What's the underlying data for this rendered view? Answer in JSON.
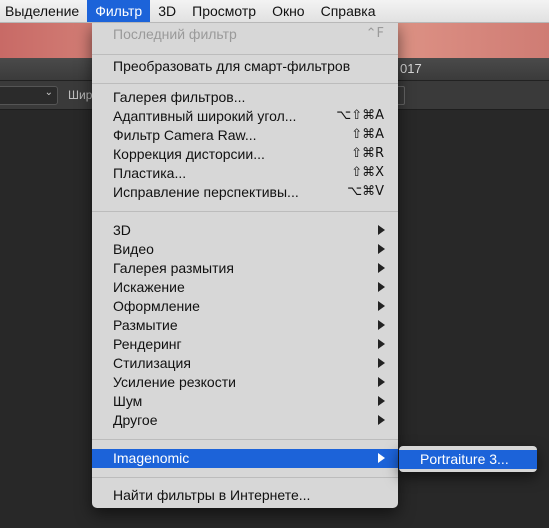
{
  "menubar": {
    "items": [
      {
        "label": "Выделение"
      },
      {
        "label": "Фильтр"
      },
      {
        "label": "3D"
      },
      {
        "label": "Просмотр"
      },
      {
        "label": "Окно"
      },
      {
        "label": "Справка"
      }
    ],
    "active": "Фильтр"
  },
  "app": {
    "title_fragment": "017",
    "options_label_fragment": "Шир"
  },
  "filter_menu": {
    "last_filter": {
      "label": "Последний фильтр",
      "shortcut": "⌃F",
      "disabled": true
    },
    "convert_smart": {
      "label": "Преобразовать для смарт-фильтров"
    },
    "gallery": {
      "label": "Галерея фильтров..."
    },
    "adaptive_wide": {
      "label": "Адаптивный широкий угол...",
      "shortcut": "⌥⇧⌘A"
    },
    "camera_raw": {
      "label": "Фильтр Camera Raw...",
      "shortcut": "⇧⌘A"
    },
    "lens_correction": {
      "label": "Коррекция дисторсии...",
      "shortcut": "⇧⌘R"
    },
    "liquify": {
      "label": "Пластика...",
      "shortcut": "⇧⌘X"
    },
    "vanishing_point": {
      "label": "Исправление перспективы...",
      "shortcut": "⌥⌘V"
    },
    "submenus": [
      {
        "label": "3D"
      },
      {
        "label": "Видео"
      },
      {
        "label": "Галерея размытия"
      },
      {
        "label": "Искажение"
      },
      {
        "label": "Оформление"
      },
      {
        "label": "Размытие"
      },
      {
        "label": "Рендеринг"
      },
      {
        "label": "Стилизация"
      },
      {
        "label": "Усиление резкости"
      },
      {
        "label": "Шум"
      },
      {
        "label": "Другое"
      }
    ],
    "imagenomic": {
      "label": "Imagenomic",
      "highlighted": true
    },
    "browse_online": {
      "label": "Найти фильтры в Интернете..."
    }
  },
  "imagenomic_submenu": {
    "items": [
      {
        "label": "Portraiture 3..."
      }
    ]
  },
  "colors": {
    "highlight": "#1c63d9",
    "menu_bg": "#d7d7d7",
    "app_bg": "#282828"
  }
}
